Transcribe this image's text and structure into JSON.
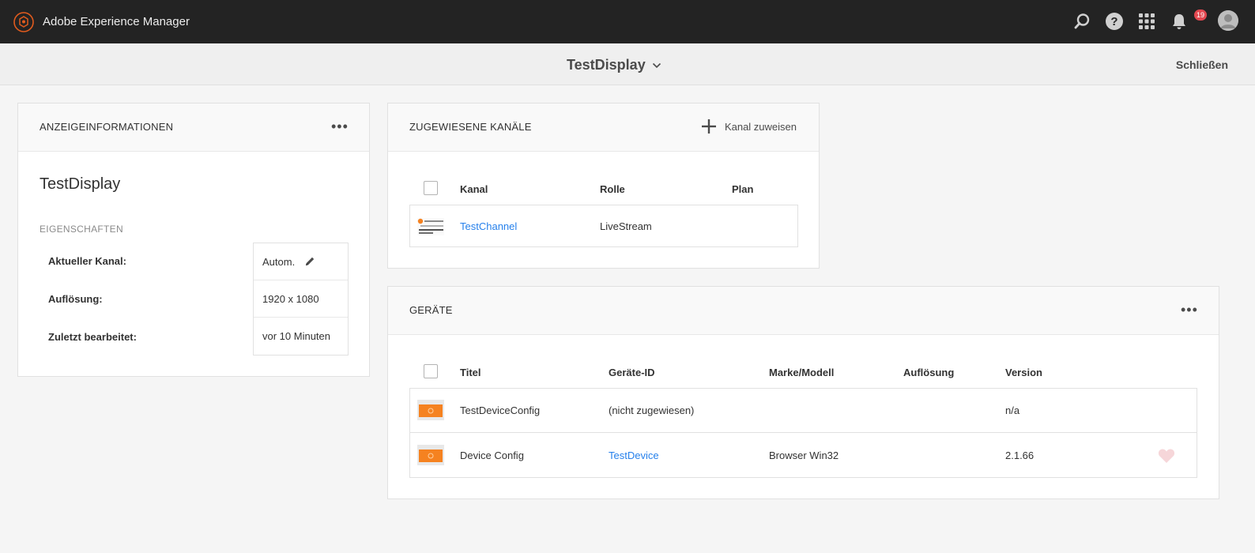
{
  "topbar": {
    "app_title": "Adobe Experience Manager",
    "icons": [
      "search-icon",
      "help-icon",
      "apps-icon",
      "bell-icon",
      "avatar"
    ],
    "notification_count": "19",
    "colors": {
      "bar": "#232323",
      "logo": "#e05b1e",
      "badge": "#e34850"
    }
  },
  "subheader": {
    "title": "TestDisplay",
    "close_label": "Schließen"
  },
  "display_info": {
    "header": "ANZEIGEINFORMATIONEN",
    "name": "TestDisplay",
    "section_label": "EIGENSCHAFTEN",
    "properties": [
      {
        "label": "Aktueller Kanal:",
        "value": "Autom."
      },
      {
        "label": "Auflösung:",
        "value": "1920 x 1080"
      },
      {
        "label": "Zuletzt bearbeitet:",
        "value": "vor 10 Minuten"
      }
    ]
  },
  "channels": {
    "header": "ZUGEWIESENE KANÄLE",
    "assign_label": "Kanal zuweisen",
    "columns": [
      "Kanal",
      "Rolle",
      "Plan"
    ],
    "rows": [
      {
        "kanal": "TestChannel",
        "rolle": "LiveStream",
        "plan": ""
      }
    ]
  },
  "devices": {
    "header": "GERÄTE",
    "columns": [
      "Titel",
      "Geräte-ID",
      "Marke/Modell",
      "Auflösung",
      "Version"
    ],
    "rows": [
      {
        "titel": "TestDeviceConfig",
        "id": "(nicht zugewiesen)",
        "marke": "",
        "aufloesung": "",
        "version": "n/a"
      },
      {
        "titel": "Device Config",
        "id": "TestDevice",
        "marke": "Browser Win32",
        "aufloesung": "",
        "version": "2.1.66"
      }
    ],
    "colors": {
      "device_thumb": "#f58220",
      "heart": "#f6d6d9"
    }
  },
  "colors": {
    "link": "#2680eb",
    "page_bg": "#f5f5f5"
  }
}
